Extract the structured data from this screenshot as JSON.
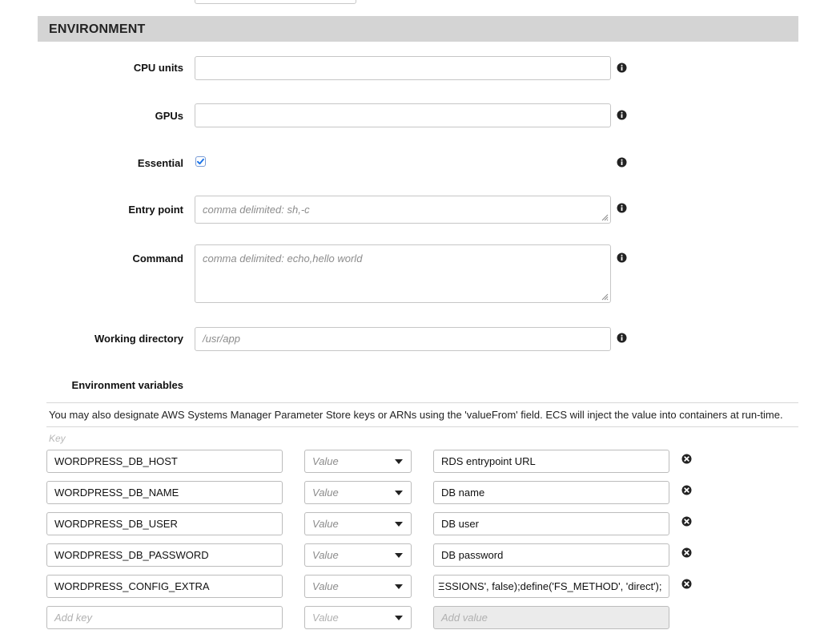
{
  "section": {
    "title": "ENVIRONMENT"
  },
  "fields": {
    "cpu_units": {
      "label": "CPU units",
      "value": ""
    },
    "gpus": {
      "label": "GPUs",
      "value": ""
    },
    "essential": {
      "label": "Essential",
      "checked": true
    },
    "entry_point": {
      "label": "Entry point",
      "placeholder": "comma delimited: sh,-c"
    },
    "command": {
      "label": "Command",
      "placeholder": "comma delimited: echo,hello world"
    },
    "working_directory": {
      "label": "Working directory",
      "placeholder": "/usr/app"
    }
  },
  "env_vars": {
    "label": "Environment variables",
    "hint": "You may also designate AWS Systems Manager Parameter Store keys or ARNs using the 'valueFrom' field. ECS will inject the value into containers at run-time.",
    "key_header": "Key",
    "rows": [
      {
        "key": "WORDPRESS_DB_HOST",
        "type": "Value",
        "value": "RDS entrypoint URL"
      },
      {
        "key": "WORDPRESS_DB_NAME",
        "type": "Value",
        "value": "DB name"
      },
      {
        "key": "WORDPRESS_DB_USER",
        "type": "Value",
        "value": "DB user"
      },
      {
        "key": "WORDPRESS_DB_PASSWORD",
        "type": "Value",
        "value": "DB password"
      },
      {
        "key": "WORDPRESS_CONFIG_EXTRA",
        "type": "Value",
        "value": "ΞSSIONS', false);define('FS_METHOD', 'direct');"
      }
    ],
    "add_row": {
      "key_placeholder": "Add key",
      "type": "Value",
      "value_placeholder": "Add value"
    }
  },
  "icons": {
    "info": "info-circle-icon",
    "remove": "remove-circle-icon",
    "dropdown": "caret-down-icon",
    "checkmark": "checkmark-icon"
  },
  "colors": {
    "header_bg": "#d4d4d4",
    "check_blue": "#1a73e8"
  }
}
